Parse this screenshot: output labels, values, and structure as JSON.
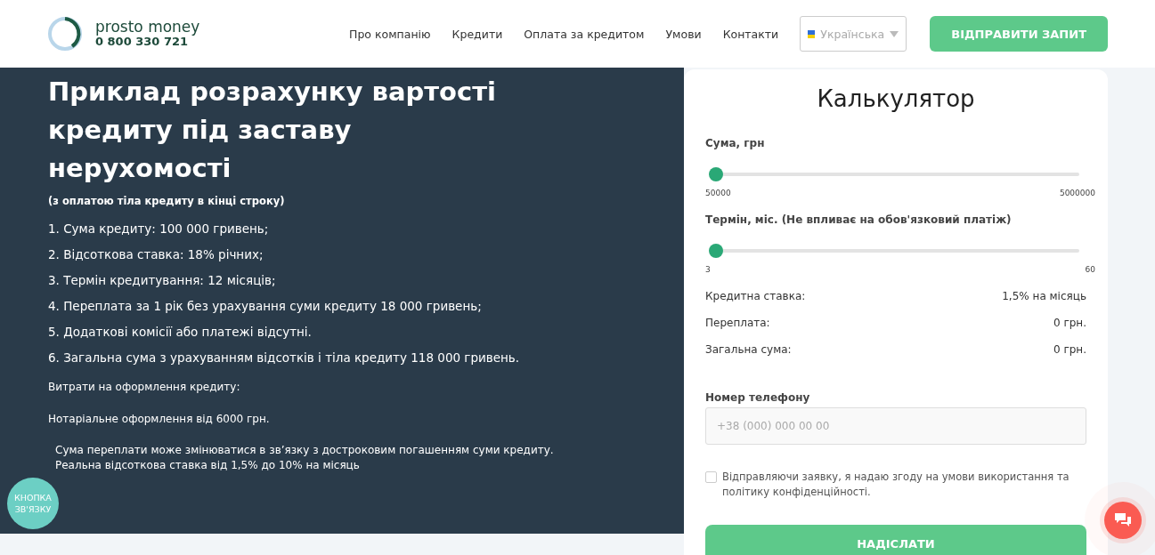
{
  "header": {
    "brand": "prosto money",
    "phone": "0 800 330 721",
    "nav": [
      {
        "label": "Про компанію"
      },
      {
        "label": "Кредити"
      },
      {
        "label": "Оплата за кредитом"
      },
      {
        "label": "Умови"
      },
      {
        "label": "Контакти"
      }
    ],
    "language": "Українська",
    "cta": "ВІДПРАВИТИ ЗАПИТ"
  },
  "article": {
    "title": "Приклад розрахунку вартості кредиту під заставу нерухомості",
    "subtitle": "(з оплатою тіла кредиту в кінці строку)",
    "items": [
      "1. Сума кредиту: 100 000 гривень;",
      "2. Відсоткова ставка: 18% річних;",
      "3. Термін кредитування: 12 місяців;",
      "4. Переплата за 1 рік без урахування суми кредиту 18 000 гривень;",
      "5. Додаткові комісії або платежі відсутні.",
      "6. Загальна сума з урахуванням відсотків і тіла кредиту 118 000 гривень."
    ],
    "costs_heading": "Витрати на оформлення кредиту:",
    "notary": "Нотаріальне оформлення від 6000 грн.",
    "notes": [
      "Сума переплати може змінюватися в зв’язку з достроковим погашенням суми кредиту.",
      "Реальна відсоткова ставка від 1,5% до 10% на місяць"
    ]
  },
  "contact_bubble": "КНОПКА ЗВ'ЯЗКУ",
  "calculator": {
    "title": "Калькулятор",
    "sliders": [
      {
        "label": "Сума, грн",
        "level": 0,
        "min": "50000",
        "max": "5000000"
      },
      {
        "label": "Термін, міс. (Не впливає на обов'язковий платіж)",
        "level": 0,
        "min": "3",
        "max": "60"
      }
    ],
    "results": [
      {
        "label": "Кредитна ставка:",
        "value": "1,5% на місяць"
      },
      {
        "label": "Переплата:",
        "value": "0 грн."
      },
      {
        "label": "Загальна сума:",
        "value": "0 грн."
      }
    ],
    "phone_label": "Номер телефону",
    "phone_placeholder": "+38 (000) 000 00 00",
    "consent": {
      "text": "Відправляючи заявку, я надаю згоду на умови використання та політику конфіденційності.",
      "checked": false
    },
    "submit": "НАДІСЛАТИ"
  }
}
